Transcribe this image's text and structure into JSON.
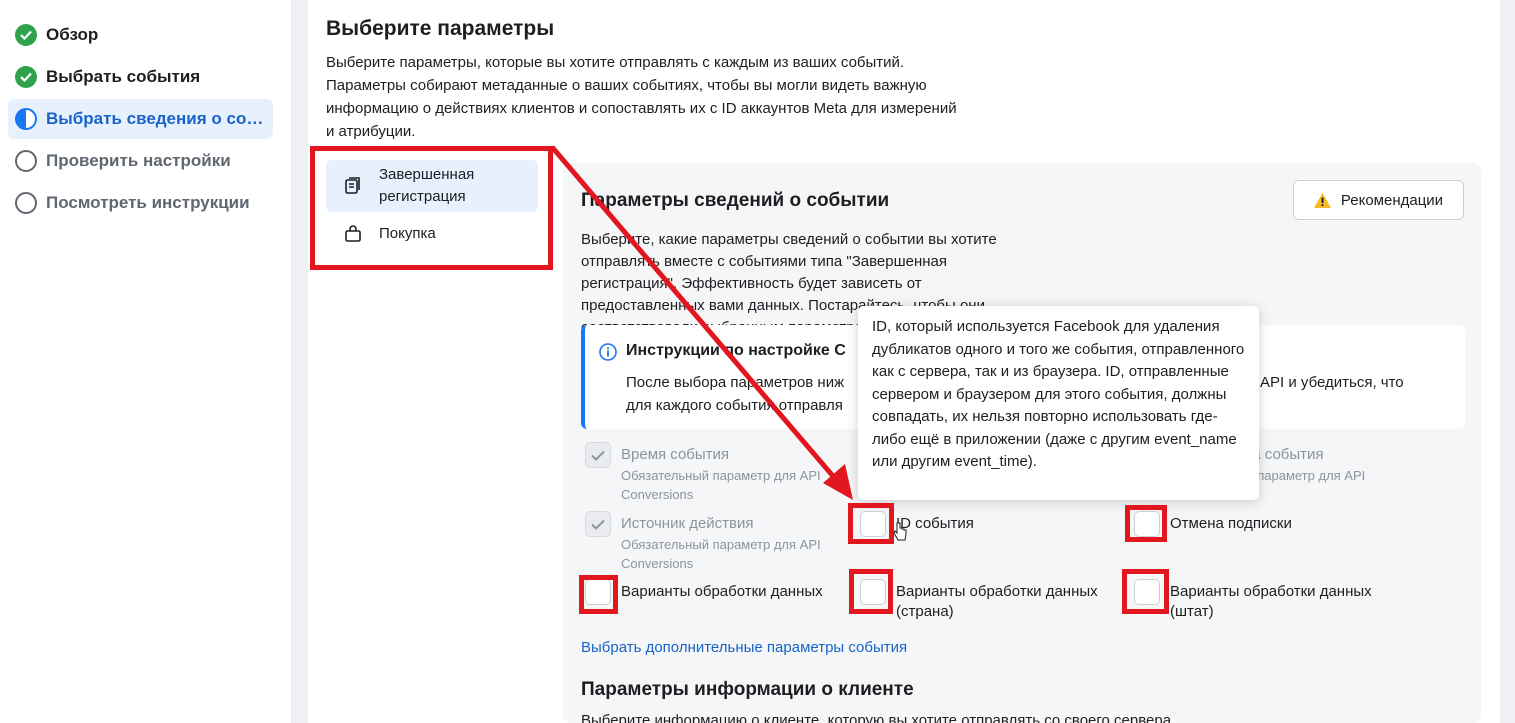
{
  "sidebar": {
    "steps": [
      {
        "label": "Обзор",
        "state": "done"
      },
      {
        "label": "Выбрать события",
        "state": "done"
      },
      {
        "label": "Выбрать сведения о событии",
        "state": "active"
      },
      {
        "label": "Проверить настройки",
        "state": "pending"
      },
      {
        "label": "Посмотреть инструкции",
        "state": "pending"
      }
    ]
  },
  "main": {
    "title": "Выберите параметры",
    "description": "Выберите параметры, которые вы хотите отправлять с каждым из ваших событий. Параметры собирают метаданные о ваших событиях, чтобы вы могли видеть важную информацию о действиях клиентов и сопоставлять их с ID аккаунтов Meta для измерений и атрибуции.",
    "events": [
      {
        "label": "Завершенная регистрация",
        "icon": "registration-icon",
        "selected": true
      },
      {
        "label": "Покупка",
        "icon": "shopping-bag-icon",
        "selected": false
      }
    ]
  },
  "card": {
    "title": "Параметры сведений о событии",
    "recommendations_label": "Рекомендации",
    "description": "Выберите, какие параметры сведений о событии вы хотите отправлять вместе с событиями типа \"Завершенная регистрация\". Эффективность будет зависеть от предоставленных вами данных. Постарайтесь, чтобы они соответствовали выбранным параметрам.",
    "info": {
      "title": "Инструкции по настройке C",
      "text_left": "После выбора параметров ниж",
      "text_left2": "для каждого события отправля",
      "text_right": "tions API и убедиться, что"
    },
    "options": {
      "event_time": {
        "label": "Время события",
        "sub": "Обязательный параметр для API Conversions",
        "checked": true,
        "disabled": true
      },
      "event_source": {
        "label": "Источник действия",
        "sub": "Обязательный параметр для API Conversions",
        "checked": true,
        "disabled": true
      },
      "event_url_partial": {
        "label": "ика события",
        "sub": "ый параметр для API"
      },
      "event_id": {
        "label": "ID события",
        "checked": false
      },
      "unsubscribe": {
        "label": "Отмена подписки",
        "checked": false
      },
      "data_processing": {
        "label": "Варианты обработки данных",
        "checked": false
      },
      "data_processing_country": {
        "label": "Варианты обработки данных (страна)",
        "checked": false
      },
      "data_processing_state": {
        "label": "Варианты обработки данных (штат)",
        "checked": false
      }
    },
    "more_link": "Выбрать дополнительные параметры события",
    "customer_title": "Параметры информации о клиенте",
    "customer_desc": "Выберите информацию о клиенте, которую вы хотите отправлять со своего сервера"
  },
  "tooltip": {
    "text": "ID, который используется Facebook для удаления дубликатов одного и того же события, отправленного как с сервера, так и из браузера. ID, отправленные сервером и браузером для этого события, должны совпадать, их нельзя повторно использовать где-либо ещё в приложении (даже с другим event_name или другим event_time)."
  },
  "colors": {
    "accent": "#1877f2",
    "success": "#31a24c",
    "annotation": "#e2161e"
  }
}
